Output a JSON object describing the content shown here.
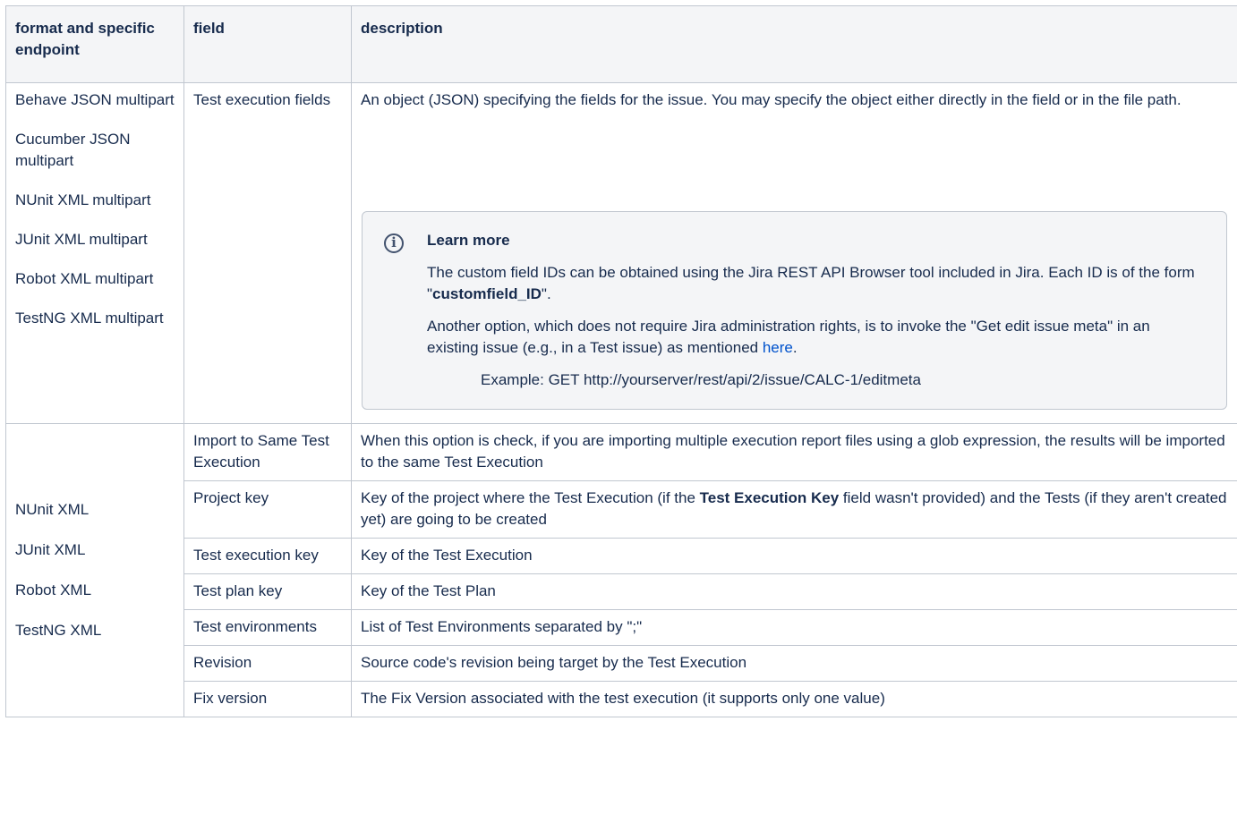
{
  "headers": {
    "format": "format and specific endpoint",
    "field": "field",
    "description": "description"
  },
  "row1": {
    "formats": [
      "Behave JSON multipart",
      "Cucumber JSON multipart",
      "NUnit XML multipart",
      "JUnit XML multipart",
      "Robot XML multipart",
      "TestNG XML multipart"
    ],
    "field": "Test execution fields",
    "description": "An object (JSON) specifying the fields for the issue. You may specify the object either directly in the field or in the file path.",
    "panel": {
      "icon": "info-icon",
      "title": "Learn more",
      "p1_before": "The custom field IDs can be obtained using the Jira REST API Browser tool included in Jira. Each ID is of the form \"",
      "p1_bold": "customfield_ID",
      "p1_after": "\".",
      "p2_before": "Another option, which does not require Jira administration rights, is to invoke the \"Get edit issue meta\" in an existing issue (e.g., in a Test issue) as mentioned ",
      "p2_link": "here",
      "p2_after": ".",
      "example": "Example: GET http://yourserver/rest/api/2/issue/CALC-1/editmeta"
    }
  },
  "group2": {
    "formats": [
      "NUnit XML",
      "JUnit XML",
      "Robot XML",
      "TestNG XML"
    ],
    "rows": [
      {
        "field": "Import to Same Test Execution",
        "description": "When this option is check, if you are importing multiple execution report files using a glob expression, the results will be imported to the same Test Execution"
      },
      {
        "field": "Project key",
        "desc_before": "Key of the project where the Test Execution (if the ",
        "desc_bold": "Test Execution Key",
        "desc_after": " field wasn't provided) and the Tests (if they aren't created yet) are going to be created"
      },
      {
        "field": "Test execution key",
        "description": "Key of the Test Execution"
      },
      {
        "field": "Test plan key",
        "description": "Key of the Test Plan"
      },
      {
        "field": "Test environments",
        "description": "List of Test Environments separated by \";\""
      },
      {
        "field": "Revision",
        "description": "Source code's revision being target by the Test Execution"
      },
      {
        "field": "Fix version",
        "description": "The Fix Version associated with the test execution (it supports only one value)"
      }
    ]
  }
}
